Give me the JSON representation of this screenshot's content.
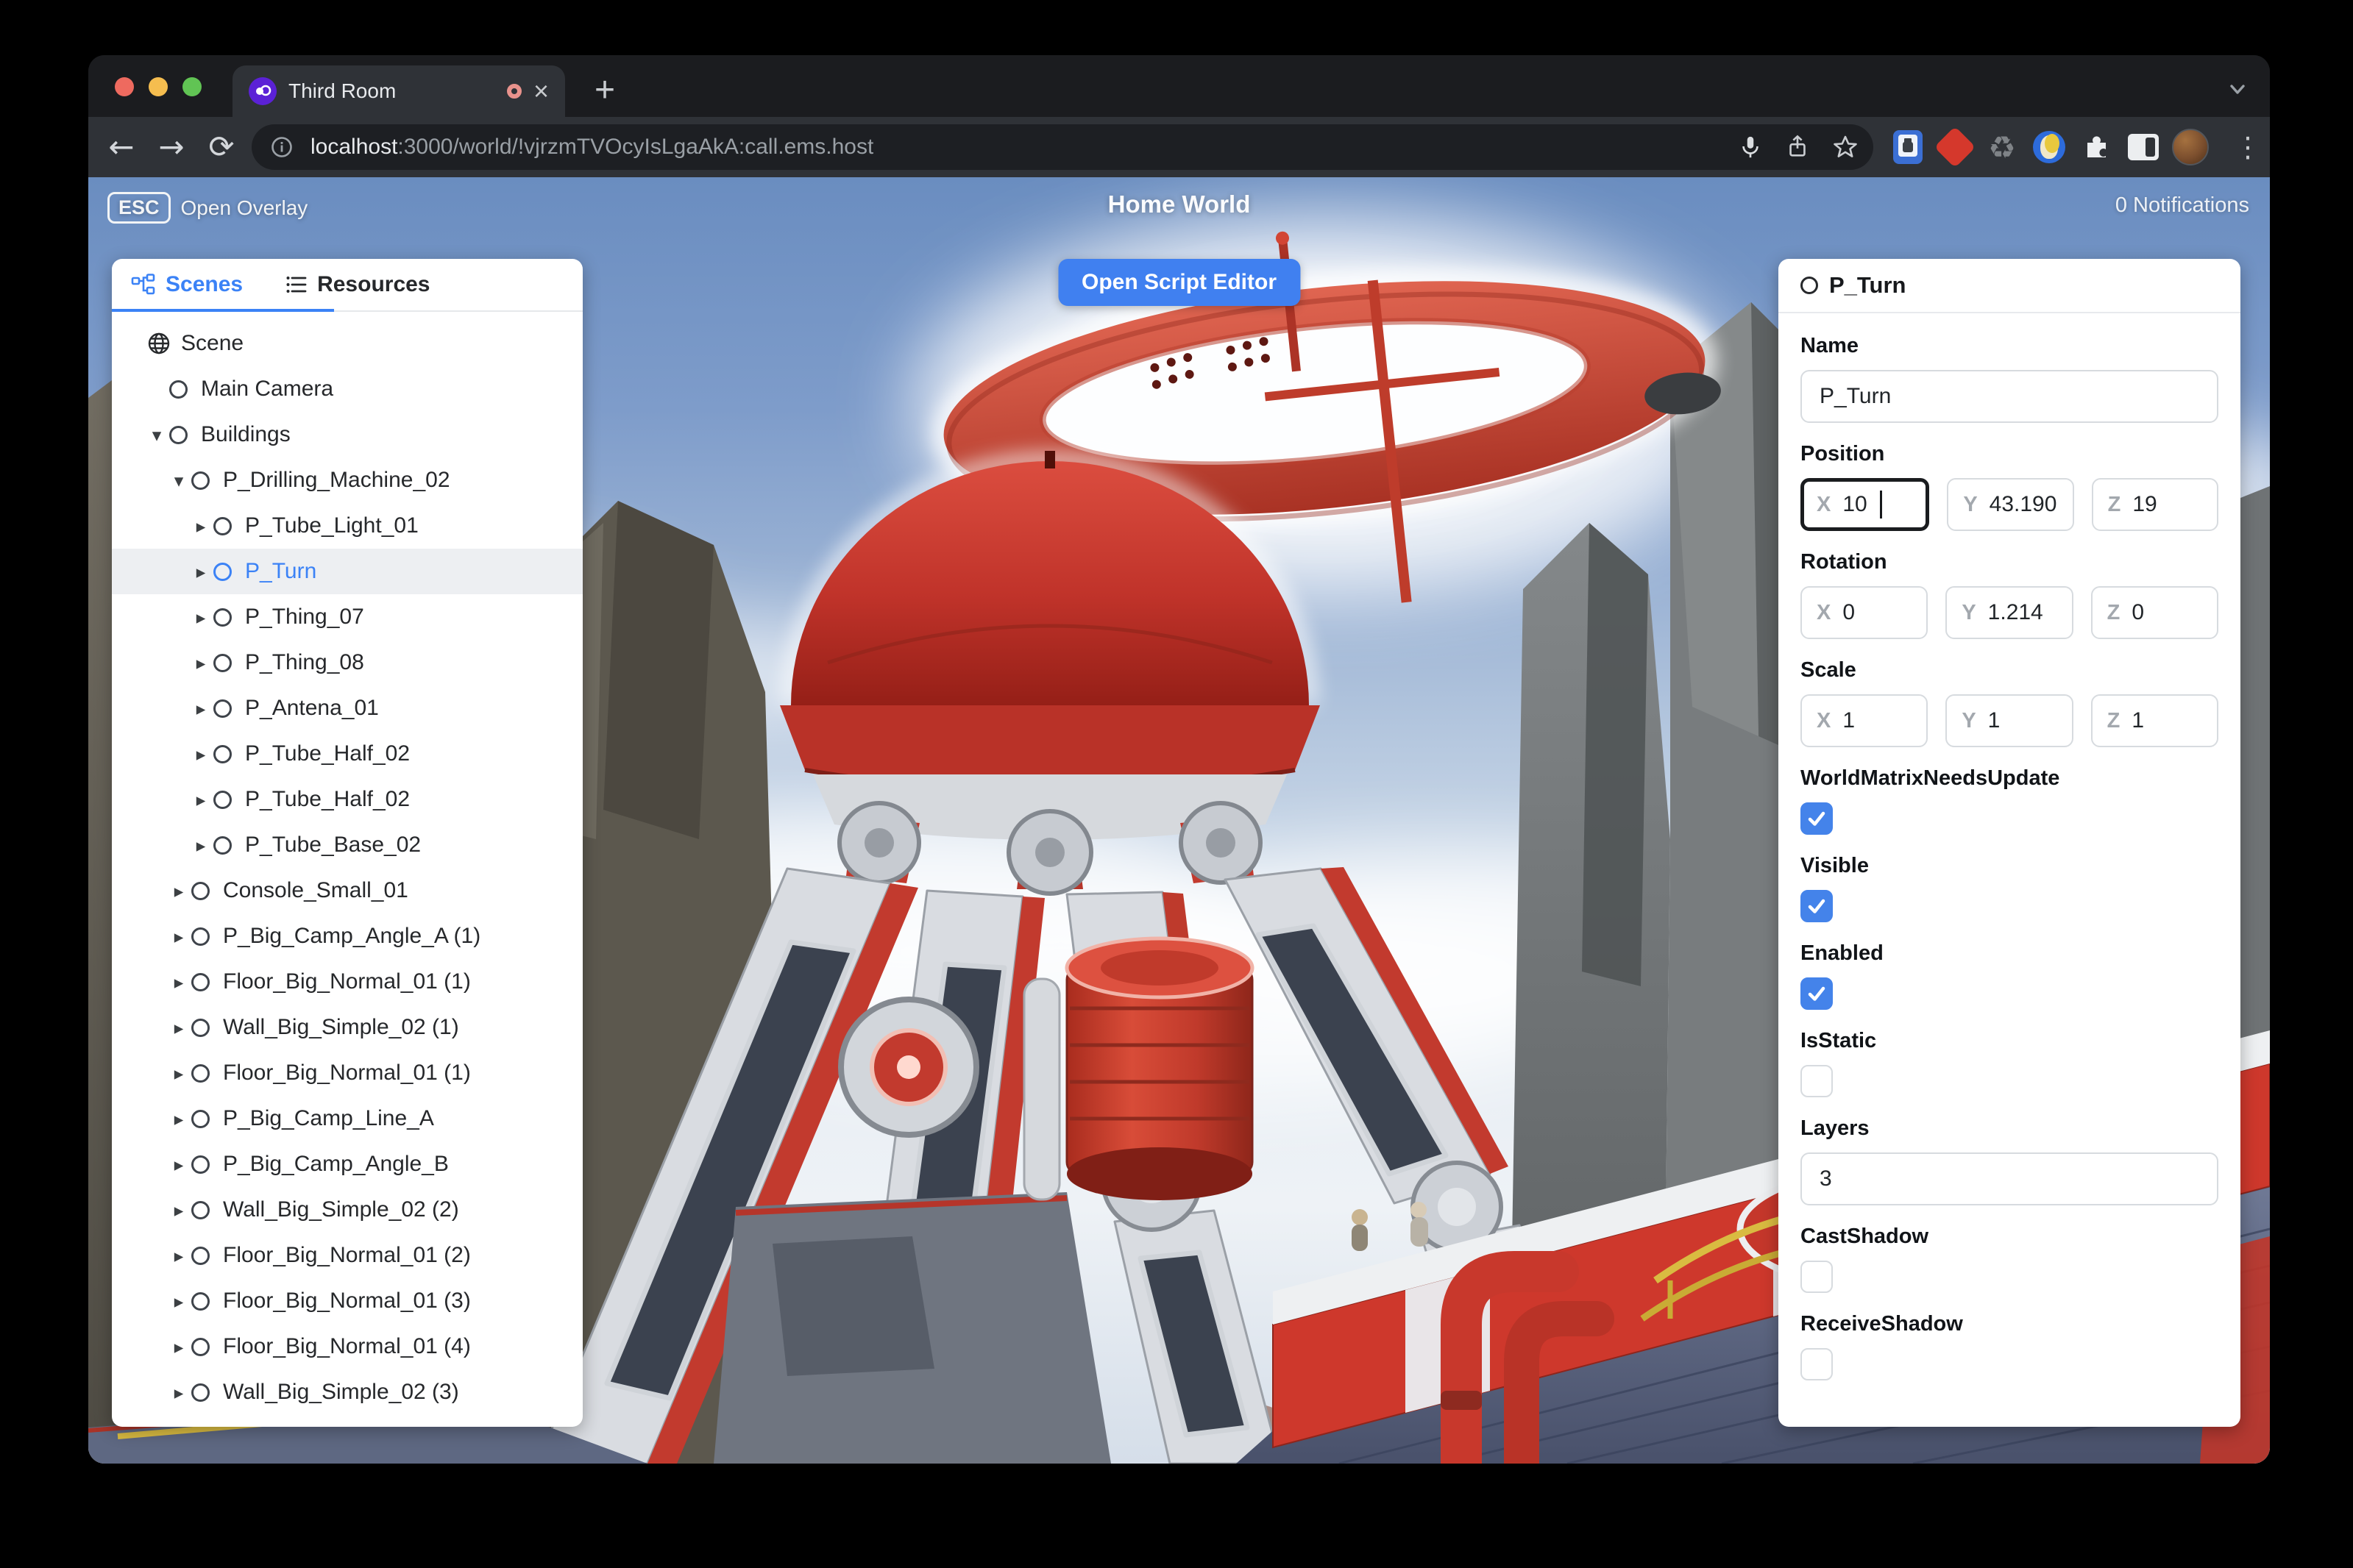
{
  "window": {
    "tab_title": "Third Room",
    "close_tab": "×",
    "new_tab": "+",
    "url_host": "localhost",
    "url_rest": ":3000/world/!vjrzmTVOcyIsLgaAkA:call.ems.host",
    "menu_dots": "⋮"
  },
  "overlay": {
    "esc_key": "ESC",
    "esc_label": "Open Overlay",
    "title": "Home World",
    "notifications": "0 Notifications",
    "script_editor_button": "Open Script Editor"
  },
  "hierarchy": {
    "tabs": [
      {
        "label": "Scenes"
      },
      {
        "label": "Resources"
      }
    ],
    "items": [
      {
        "label": "Scene",
        "depth": 0,
        "icon": "globe",
        "caret": null
      },
      {
        "label": "Main Camera",
        "depth": 1,
        "icon": "circle",
        "caret": null
      },
      {
        "label": "Buildings",
        "depth": 1,
        "icon": "circle",
        "caret": "down"
      },
      {
        "label": "P_Drilling_Machine_02",
        "depth": 2,
        "icon": "circle",
        "caret": "down"
      },
      {
        "label": "P_Tube_Light_01",
        "depth": 3,
        "icon": "circle",
        "caret": "right"
      },
      {
        "label": "P_Turn",
        "depth": 3,
        "icon": "circle",
        "caret": "right",
        "selected": true
      },
      {
        "label": "P_Thing_07",
        "depth": 3,
        "icon": "circle",
        "caret": "right"
      },
      {
        "label": "P_Thing_08",
        "depth": 3,
        "icon": "circle",
        "caret": "right"
      },
      {
        "label": "P_Antena_01",
        "depth": 3,
        "icon": "circle",
        "caret": "right"
      },
      {
        "label": "P_Tube_Half_02",
        "depth": 3,
        "icon": "circle",
        "caret": "right"
      },
      {
        "label": "P_Tube_Half_02",
        "depth": 3,
        "icon": "circle",
        "caret": "right"
      },
      {
        "label": "P_Tube_Base_02",
        "depth": 3,
        "icon": "circle",
        "caret": "right"
      },
      {
        "label": "Console_Small_01",
        "depth": 2,
        "icon": "circle",
        "caret": "right"
      },
      {
        "label": "P_Big_Camp_Angle_A (1)",
        "depth": 2,
        "icon": "circle",
        "caret": "right"
      },
      {
        "label": "Floor_Big_Normal_01 (1)",
        "depth": 2,
        "icon": "circle",
        "caret": "right"
      },
      {
        "label": "Wall_Big_Simple_02 (1)",
        "depth": 2,
        "icon": "circle",
        "caret": "right"
      },
      {
        "label": "Floor_Big_Normal_01 (1)",
        "depth": 2,
        "icon": "circle",
        "caret": "right"
      },
      {
        "label": "P_Big_Camp_Line_A",
        "depth": 2,
        "icon": "circle",
        "caret": "right"
      },
      {
        "label": "P_Big_Camp_Angle_B",
        "depth": 2,
        "icon": "circle",
        "caret": "right"
      },
      {
        "label": "Wall_Big_Simple_02 (2)",
        "depth": 2,
        "icon": "circle",
        "caret": "right"
      },
      {
        "label": "Floor_Big_Normal_01 (2)",
        "depth": 2,
        "icon": "circle",
        "caret": "right"
      },
      {
        "label": "Floor_Big_Normal_01 (3)",
        "depth": 2,
        "icon": "circle",
        "caret": "right"
      },
      {
        "label": "Floor_Big_Normal_01 (4)",
        "depth": 2,
        "icon": "circle",
        "caret": "right"
      },
      {
        "label": "Wall_Big_Simple_02 (3)",
        "depth": 2,
        "icon": "circle",
        "caret": "right"
      }
    ]
  },
  "inspector": {
    "title": "P_Turn",
    "name_label": "Name",
    "name_value": "P_Turn",
    "axis_prefixes": {
      "x": "X",
      "y": "Y",
      "z": "Z"
    },
    "position": {
      "label": "Position",
      "x": "10",
      "y": "43.190",
      "z": "19"
    },
    "rotation": {
      "label": "Rotation",
      "x": "0",
      "y": "1.214",
      "z": "0"
    },
    "scale": {
      "label": "Scale",
      "x": "1",
      "y": "1",
      "z": "1"
    },
    "fields": [
      {
        "type": "checkbox",
        "label": "WorldMatrixNeedsUpdate",
        "checked": true
      },
      {
        "type": "checkbox",
        "label": "Visible",
        "checked": true
      },
      {
        "type": "checkbox",
        "label": "Enabled",
        "checked": true
      },
      {
        "type": "checkbox",
        "label": "IsStatic",
        "checked": false
      },
      {
        "type": "input",
        "label": "Layers",
        "value": "3"
      },
      {
        "type": "checkbox",
        "label": "CastShadow",
        "checked": false
      },
      {
        "type": "checkbox",
        "label": "ReceiveShadow",
        "checked": false
      }
    ]
  },
  "colors": {
    "accent_blue": "#3b82f6",
    "checkbox_blue": "#4483ea",
    "button_blue": "#4080f0",
    "machine_red": "#c43a2c",
    "selected_row_bg": "#edeff2"
  }
}
